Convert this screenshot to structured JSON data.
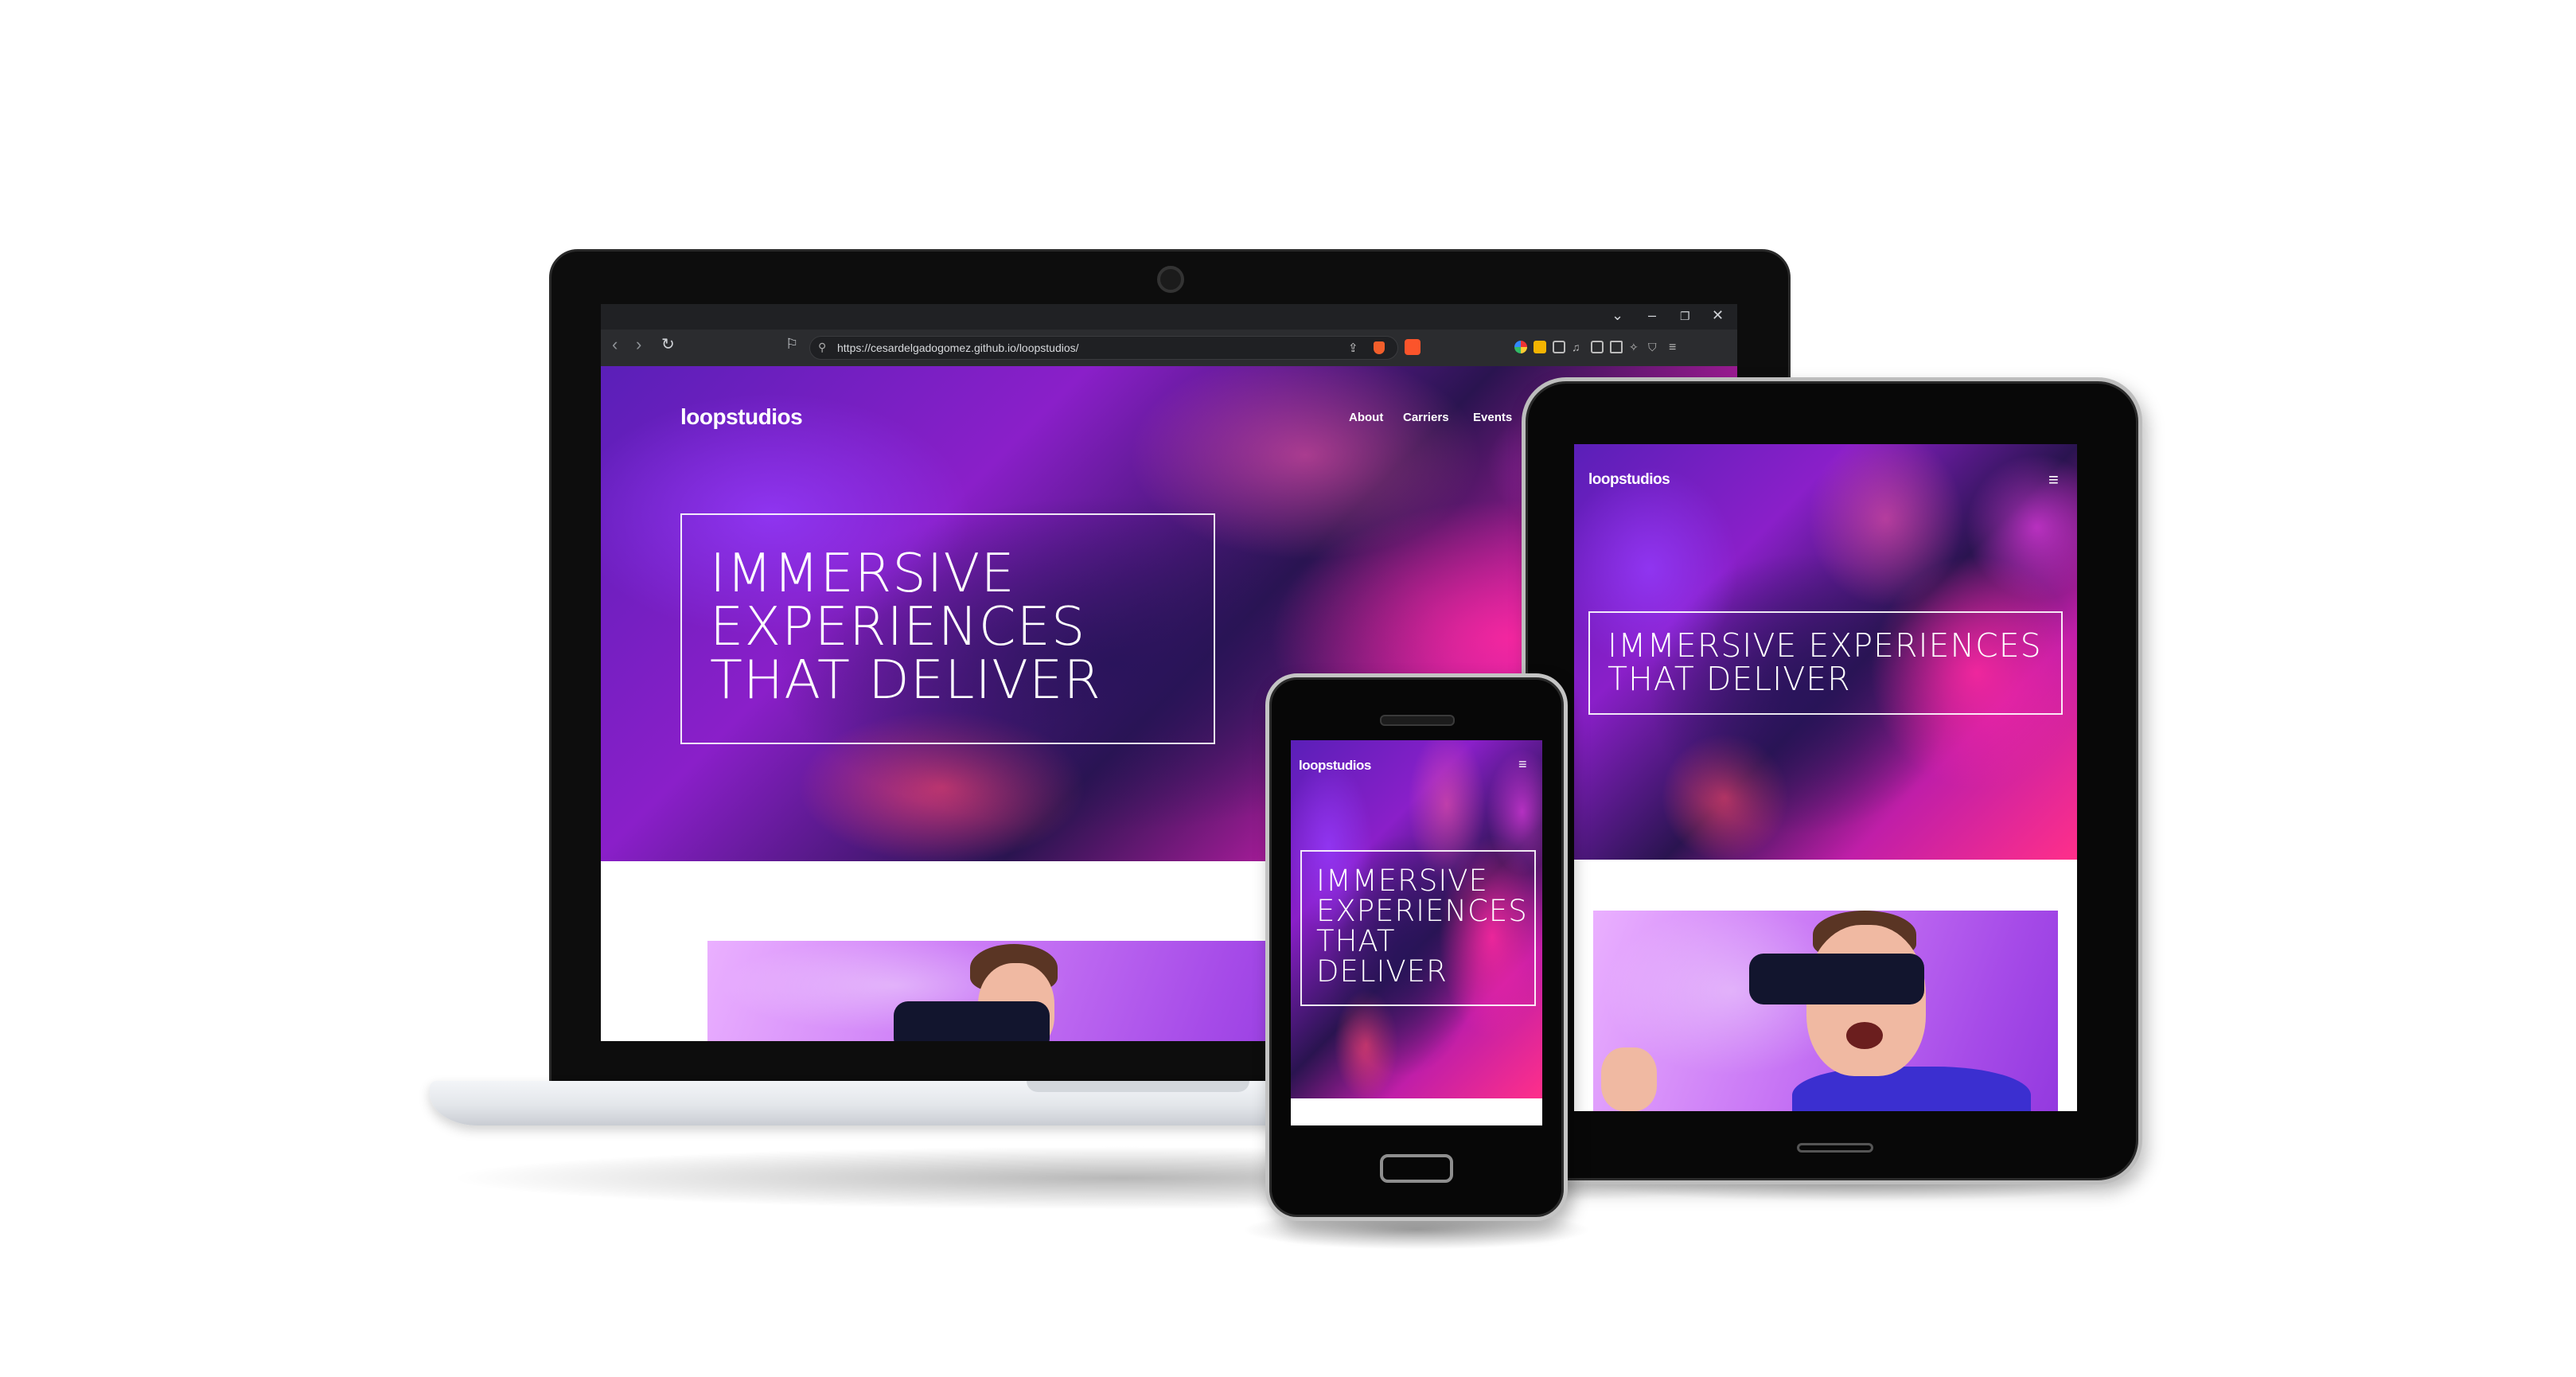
{
  "browser": {
    "url": "https://cesardelgadogomez.github.io/loopstudios/"
  },
  "site": {
    "logo": "loopstudios",
    "nav": [
      "About",
      "Carriers",
      "Events"
    ],
    "heading_lines": [
      "IMMERSIVE",
      "EXPERIENCES",
      "THAT DELIVER"
    ],
    "tablet_heading_lines": [
      "IMMERSIVE EXPERIENCES",
      "THAT DELIVER"
    ],
    "phone_heading_lines": [
      "IMMERSIVE",
      "EXPERIENCES",
      "THAT",
      "DELIVER"
    ],
    "menu_glyph": "≡"
  },
  "icons": {
    "back": "back-arrow-icon",
    "forward": "forward-arrow-icon",
    "reload": "reload-icon",
    "bookmark": "bookmark-icon",
    "share": "share-icon",
    "menu": "hamburger-menu-icon"
  },
  "colors": {
    "hero_magenta": "#ff2f8a",
    "hero_purple": "#5a1fb8",
    "browser_dark": "#202124",
    "vr_lilac": "#c876f5"
  }
}
